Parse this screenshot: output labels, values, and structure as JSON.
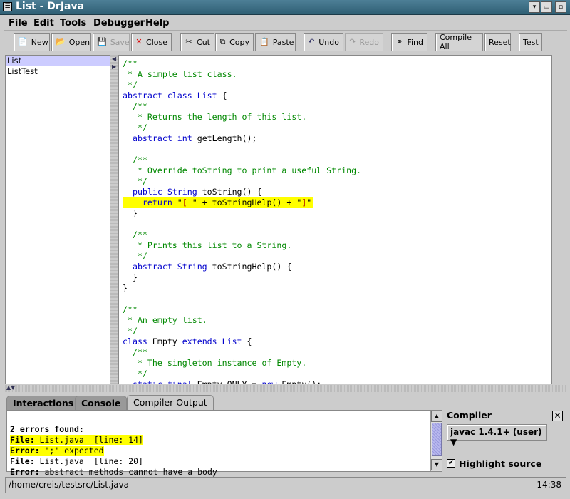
{
  "window": {
    "title": "List - DrJava"
  },
  "menu": [
    "File",
    "Edit",
    "Tools",
    "Debugger",
    "Help"
  ],
  "toolbar": {
    "new": "New",
    "open": "Open",
    "save": "Save",
    "close": "Close",
    "cut": "Cut",
    "copy": "Copy",
    "paste": "Paste",
    "undo": "Undo",
    "redo": "Redo",
    "find": "Find",
    "compile_all": "Compile All",
    "reset": "Reset",
    "test": "Test"
  },
  "documents": [
    {
      "name": "List",
      "selected": true
    },
    {
      "name": "ListTest",
      "selected": false
    }
  ],
  "editor": {
    "lines": [
      [
        [
          "c",
          "/**"
        ]
      ],
      [
        [
          "c",
          " * A simple list class."
        ]
      ],
      [
        [
          "c",
          " */"
        ]
      ],
      [
        [
          "k",
          "abstract class List"
        ],
        [
          "p",
          " {"
        ]
      ],
      [
        [
          "c",
          "  /**"
        ]
      ],
      [
        [
          "c",
          "   * Returns the length of this list."
        ]
      ],
      [
        [
          "c",
          "   */"
        ]
      ],
      [
        [
          "k",
          "  abstract int"
        ],
        [
          "p",
          " getLength();"
        ]
      ],
      [
        [
          "p",
          ""
        ]
      ],
      [
        [
          "c",
          "  /**"
        ]
      ],
      [
        [
          "c",
          "   * Override toString to print a useful String."
        ]
      ],
      [
        [
          "c",
          "   */"
        ]
      ],
      [
        [
          "k",
          "  public String"
        ],
        [
          "p",
          " toString() {"
        ]
      ],
      [
        [
          "k",
          "    return"
        ],
        [
          "p",
          " \""
        ],
        [
          "s",
          "[ "
        ],
        [
          "p",
          "\" + toStringHelp() + \""
        ],
        [
          "s",
          "]"
        ],
        [
          "p",
          "\""
        ]
      ],
      [
        [
          "p",
          "  }"
        ]
      ],
      [
        [
          "p",
          ""
        ]
      ],
      [
        [
          "c",
          "  /**"
        ]
      ],
      [
        [
          "c",
          "   * Prints this list to a String."
        ]
      ],
      [
        [
          "c",
          "   */"
        ]
      ],
      [
        [
          "k",
          "  abstract String"
        ],
        [
          "p",
          " toStringHelp() {"
        ]
      ],
      [
        [
          "p",
          "  }"
        ]
      ],
      [
        [
          "p",
          "}"
        ]
      ],
      [
        [
          "p",
          ""
        ]
      ],
      [
        [
          "c",
          "/**"
        ]
      ],
      [
        [
          "c",
          " * An empty list."
        ]
      ],
      [
        [
          "c",
          " */"
        ]
      ],
      [
        [
          "k",
          "class"
        ],
        [
          "p",
          " Empty "
        ],
        [
          "k",
          "extends List"
        ],
        [
          "p",
          " {"
        ]
      ],
      [
        [
          "c",
          "  /**"
        ]
      ],
      [
        [
          "c",
          "   * The singleton instance of Empty."
        ]
      ],
      [
        [
          "c",
          "   */"
        ]
      ],
      [
        [
          "k",
          "  static final"
        ],
        [
          "p",
          " Empty ONLY = "
        ],
        [
          "k",
          "new"
        ],
        [
          "p",
          " Empty();"
        ]
      ]
    ],
    "highlighted_line": 13
  },
  "tabs": [
    {
      "label": "Interactions",
      "active": false
    },
    {
      "label": "Console",
      "active": false
    },
    {
      "label": "Compiler Output",
      "active": true
    }
  ],
  "output": {
    "summary": "2 errors found:",
    "errors": [
      {
        "file_label": "File:",
        "file": " List.java  [line: 14]",
        "error_label": "Error:",
        "error": " ';' expected",
        "highlighted": true
      },
      {
        "file_label": "File:",
        "file": " List.java  [line: 20]",
        "error_label": "Error:",
        "error": " abstract methods cannot have a body",
        "highlighted": false
      }
    ]
  },
  "compiler": {
    "label": "Compiler",
    "selected": "javac 1.4.1+ (user)",
    "highlight_source_label": "Highlight source",
    "highlight_source": true
  },
  "status": {
    "path": "/home/creis/testsrc/List.java",
    "position": "14:38"
  },
  "colors": {
    "titlebar": "#3a6a80",
    "highlight": "#ffff00",
    "comment": "#008800",
    "keyword": "#0000cc",
    "string": "#aa0000",
    "selection": "#ccccff"
  }
}
